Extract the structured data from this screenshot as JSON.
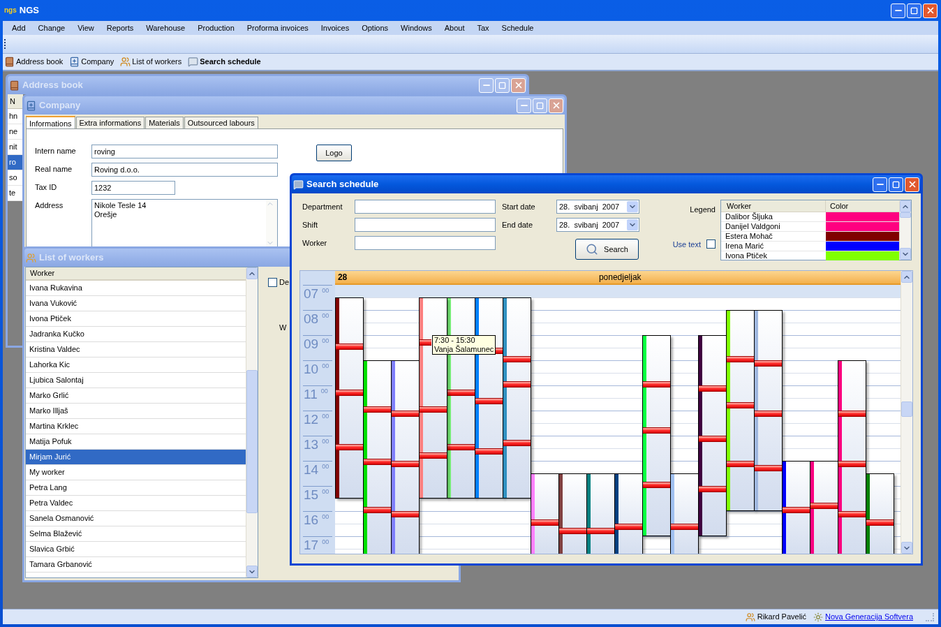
{
  "app": {
    "logo": "ngs",
    "title": "NGS"
  },
  "menu": [
    "Add",
    "Change",
    "View",
    "Reports",
    "Warehouse",
    "Production",
    "Proforma invoices",
    "Invoices",
    "Options",
    "Windows",
    "About",
    "Tax",
    "Schedule"
  ],
  "toolbar": [
    {
      "label": "Address book",
      "selected": false
    },
    {
      "label": "Company",
      "selected": false
    },
    {
      "label": "List of workers",
      "selected": false
    },
    {
      "label": "Search schedule",
      "selected": true
    }
  ],
  "address_book": {
    "title": "Address book",
    "active": false,
    "column_header": "N",
    "rows": [
      {
        "text": "hn",
        "selected": false
      },
      {
        "text": "ne",
        "selected": false
      },
      {
        "text": "nit",
        "selected": false
      },
      {
        "text": "ro",
        "selected": true
      },
      {
        "text": "so",
        "selected": false
      },
      {
        "text": "te",
        "selected": false
      }
    ]
  },
  "company": {
    "title": "Company",
    "active": false,
    "tabs": [
      {
        "label": "Informations",
        "selected": true
      },
      {
        "label": "Extra informations",
        "selected": false
      },
      {
        "label": "Materials",
        "selected": false
      },
      {
        "label": "Outsourced labours",
        "selected": false
      }
    ],
    "fields": [
      {
        "kind": "wide",
        "label": "Intern name",
        "value": "roving"
      },
      {
        "kind": "wide",
        "label": "Real name",
        "value": "Roving d.o.o."
      },
      {
        "kind": "short",
        "label": "Tax ID",
        "value": "1232"
      },
      {
        "kind": "multiline",
        "label": "Address",
        "value": "Nikole Tesle 14\nOrešje"
      }
    ],
    "logo_button": "Logo"
  },
  "list_of_workers": {
    "title": "List of workers",
    "active": false,
    "column_header": "Worker",
    "rows": [
      {
        "name": "Ivana Rukavina",
        "selected": false
      },
      {
        "name": "Ivana Vuković",
        "selected": false
      },
      {
        "name": "Ivona Ptiček",
        "selected": false
      },
      {
        "name": "Jadranka Kučko",
        "selected": false
      },
      {
        "name": "Kristina Valdec",
        "selected": false
      },
      {
        "name": "Lahorka Kic",
        "selected": false
      },
      {
        "name": "Ljubica Salontaj",
        "selected": false
      },
      {
        "name": "Marko Grlić",
        "selected": false
      },
      {
        "name": "Marko Illjaš",
        "selected": false
      },
      {
        "name": "Martina Krklec",
        "selected": false
      },
      {
        "name": "Matija Pofuk",
        "selected": false
      },
      {
        "name": "Mirjam Jurić",
        "selected": true
      },
      {
        "name": "My worker",
        "selected": false
      },
      {
        "name": "Petra Lang",
        "selected": false
      },
      {
        "name": "Petra Valdec",
        "selected": false
      },
      {
        "name": "Sanela Osmanović",
        "selected": false
      },
      {
        "name": "Selma Blažević",
        "selected": false
      },
      {
        "name": "Slavica Grbić",
        "selected": false
      },
      {
        "name": "Tamara Grbanović",
        "selected": false
      }
    ],
    "checkbox": {
      "label": "De",
      "checked": false
    },
    "label": "W"
  },
  "search_schedule": {
    "title": "Search schedule",
    "active": true,
    "filters": [
      {
        "label": "Department"
      },
      {
        "label": "Shift"
      },
      {
        "label": "Worker"
      }
    ],
    "dates": [
      {
        "label": "Start date",
        "value": "28.  svibanj  2007"
      },
      {
        "label": "End date",
        "value": "28.  svibanj  2007"
      }
    ],
    "search_button": "Search",
    "legend": {
      "label": "Legend",
      "columns": [
        "Worker",
        "Color"
      ],
      "rows": [
        {
          "worker": "Dalibor Šljuka",
          "color": "#ff0080"
        },
        {
          "worker": "Danijel Valdgoni",
          "color": "#ff0080"
        },
        {
          "worker": "Estera Mohač",
          "color": "#800000"
        },
        {
          "worker": "Irena Marić",
          "color": "#0000ff"
        },
        {
          "worker": "Ivona Ptiček",
          "color": "#80ff00"
        }
      ]
    },
    "use_text": {
      "label": "Use text",
      "checked": false
    },
    "calendar": {
      "day": "28",
      "weekday": "ponedjeljak",
      "hours": [
        {
          "hour": "07",
          "minutes": "00"
        },
        {
          "hour": "08",
          "minutes": "00"
        },
        {
          "hour": "09",
          "minutes": "00"
        },
        {
          "hour": "10",
          "minutes": "00"
        },
        {
          "hour": "11",
          "minutes": "00"
        },
        {
          "hour": "12",
          "minutes": "00"
        },
        {
          "hour": "13",
          "minutes": "00"
        },
        {
          "hour": "14",
          "minutes": "00"
        },
        {
          "hour": "15",
          "minutes": "00"
        },
        {
          "hour": "16",
          "minutes": "00"
        },
        {
          "hour": "17",
          "minutes": "00"
        }
      ],
      "shifts": [
        {
          "color": "#800000"
        },
        {
          "color": "#00e000"
        },
        {
          "color": "#8080ff"
        },
        {
          "color": "#ff8080",
          "tooltip": {
            "time": "7:30 - 15:30",
            "worker": "Vanja Šalamunec"
          }
        },
        {
          "color": "#80ff80"
        },
        {
          "color": "#0080ff"
        },
        {
          "color": "#3090c0"
        },
        {
          "color": "#ff80ff"
        },
        {
          "color": "#804040"
        },
        {
          "color": "#008080"
        },
        {
          "color": "#004080"
        },
        {
          "color": "#00ff40"
        },
        {
          "color": "#a0c0f0"
        },
        {
          "color": "#400040"
        },
        {
          "color": "#80ff00"
        },
        {
          "color": "#a0b8e0"
        },
        {
          "color": "#0000ff"
        },
        {
          "color": "#ff0080"
        },
        {
          "color": "#ff0080"
        },
        {
          "color": "#008000"
        }
      ]
    }
  },
  "status_bar": {
    "user": "Rikard Pavelić",
    "link": "Nova Generacija Softvera"
  }
}
